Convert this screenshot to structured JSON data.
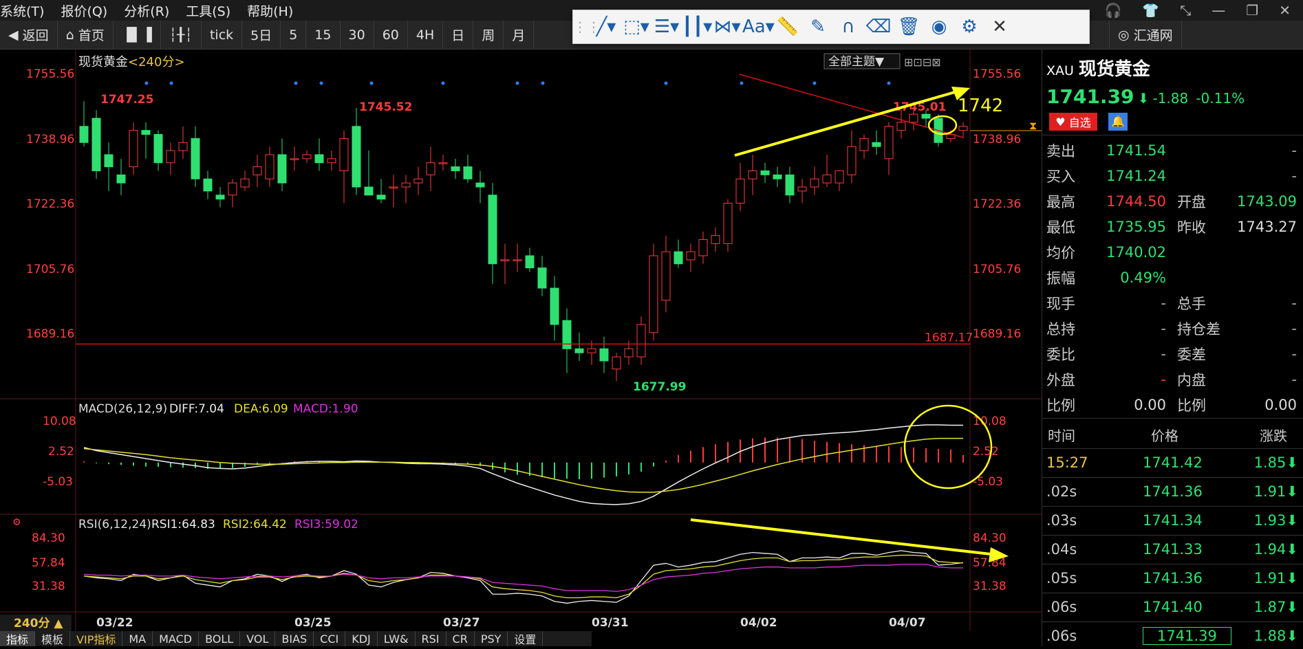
{
  "menu": [
    "系统(T)",
    "报价(Q)",
    "分析(R)",
    "工具(S)",
    "帮助(H)"
  ],
  "window_controls": [
    "headset-icon",
    "shirt-icon",
    "collapse-icon",
    "minimize-icon",
    "restore-icon",
    "close-icon"
  ],
  "toolbar": {
    "back": "返回",
    "home": "首页",
    "periods": [
      "tick",
      "5日",
      "5",
      "15",
      "30",
      "60",
      "4H",
      "日",
      "周",
      "月"
    ],
    "site": "汇通网"
  },
  "drawbar": {
    "font_label": "Aa",
    "tools": [
      "line-tool-icon",
      "rect-tool-icon",
      "fib-tool-icon",
      "channel-tool-icon",
      "pattern-tool-icon",
      "text-tool-icon",
      "ruler-icon",
      "pen-icon",
      "magnet-icon",
      "eraser-icon",
      "trash-icon",
      "eye-icon",
      "gear-icon",
      "close-icon"
    ]
  },
  "chart": {
    "title": "现货黄金",
    "period_label": "<240分>",
    "theme_button": "全部主题▼",
    "price_ticks": [
      "1755.56",
      "1738.96",
      "1722.36",
      "1705.76",
      "1689.16"
    ],
    "high_labels": [
      "1747.25",
      "1745.52",
      "1745.01"
    ],
    "low_label": "1677.99",
    "hline_label": "1687.17",
    "annotation": "1742",
    "date_ticks": [
      "03/22",
      "03/25",
      "03/27",
      "03/31",
      "04/02",
      "04/07"
    ],
    "macd_header": {
      "name": "MACD(26,12,9)",
      "diff": "DIFF:7.04",
      "dea": "DEA:6.09",
      "macd": "MACD:1.90"
    },
    "macd_ticks": [
      "10.08",
      "2.52",
      "-5.03"
    ],
    "rsi_header": {
      "name": "RSI(6,12,24)",
      "rsi1": "RSI1:64.83",
      "rsi2": "RSI2:64.42",
      "rsi3": "RSI3:59.02"
    },
    "rsi_ticks": [
      "84.30",
      "57.84",
      "31.38"
    ],
    "period_select": "240分 ▲"
  },
  "chart_data": {
    "type": "candlestick",
    "title": "现货黄金<240分>",
    "ylim": [
      1675,
      1760
    ],
    "candles": [
      [
        1741,
        1747.25,
        1736,
        1737
      ],
      [
        1743,
        1745,
        1728,
        1730
      ],
      [
        1734,
        1737,
        1725,
        1731
      ],
      [
        1729,
        1733,
        1724,
        1727
      ],
      [
        1731,
        1742,
        1729,
        1740
      ],
      [
        1740,
        1742,
        1733,
        1739
      ],
      [
        1739,
        1740,
        1730,
        1732
      ],
      [
        1732,
        1737,
        1729,
        1735
      ],
      [
        1735,
        1741,
        1733,
        1737
      ],
      [
        1738,
        1741,
        1726,
        1728
      ],
      [
        1728,
        1730,
        1723,
        1725
      ],
      [
        1724,
        1726,
        1721,
        1723
      ],
      [
        1724,
        1728,
        1721,
        1727
      ],
      [
        1726,
        1730,
        1725,
        1728
      ],
      [
        1729,
        1734,
        1726,
        1731
      ],
      [
        1728,
        1736,
        1726,
        1734
      ],
      [
        1734,
        1738,
        1725,
        1727
      ],
      [
        1733,
        1736,
        1730,
        1733
      ],
      [
        1733,
        1735,
        1732,
        1734
      ],
      [
        1734,
        1738,
        1730,
        1732
      ],
      [
        1732,
        1735,
        1730,
        1733
      ],
      [
        1730,
        1740,
        1722,
        1738
      ],
      [
        1741,
        1745.52,
        1724,
        1726
      ],
      [
        1726,
        1735,
        1724,
        1724
      ],
      [
        1724,
        1728,
        1722,
        1723
      ],
      [
        1726,
        1729,
        1721,
        1726
      ],
      [
        1726,
        1729,
        1722,
        1727
      ],
      [
        1727,
        1731,
        1724,
        1728
      ],
      [
        1729,
        1736,
        1725,
        1732
      ],
      [
        1732,
        1734,
        1730,
        1732
      ],
      [
        1731,
        1733,
        1728,
        1730
      ],
      [
        1731,
        1734,
        1727,
        1728
      ],
      [
        1727,
        1730,
        1722,
        1726
      ],
      [
        1724,
        1727,
        1702,
        1707
      ],
      [
        1708,
        1712,
        1702,
        1708
      ],
      [
        1708,
        1712,
        1705,
        1708
      ],
      [
        1709,
        1711,
        1705,
        1706
      ],
      [
        1706,
        1709,
        1699,
        1701
      ],
      [
        1701,
        1704,
        1688,
        1692
      ],
      [
        1693,
        1696,
        1680,
        1686
      ],
      [
        1686,
        1690,
        1683,
        1685
      ],
      [
        1685,
        1688,
        1682,
        1686
      ],
      [
        1686,
        1689,
        1680,
        1683
      ],
      [
        1681,
        1685,
        1677.99,
        1684
      ],
      [
        1684,
        1688,
        1682,
        1686
      ],
      [
        1684,
        1694,
        1682,
        1692
      ],
      [
        1690,
        1712,
        1688,
        1709
      ],
      [
        1698,
        1714,
        1695,
        1710
      ],
      [
        1710,
        1713,
        1706,
        1707
      ],
      [
        1708,
        1712,
        1705,
        1710
      ],
      [
        1709,
        1715,
        1707,
        1713
      ],
      [
        1712,
        1716,
        1710,
        1714
      ],
      [
        1712,
        1723,
        1710,
        1722
      ],
      [
        1722,
        1732,
        1720,
        1728
      ],
      [
        1728,
        1734,
        1724,
        1730
      ],
      [
        1730,
        1732,
        1727,
        1729
      ],
      [
        1729,
        1731,
        1726,
        1728
      ],
      [
        1729,
        1731,
        1722,
        1724
      ],
      [
        1725,
        1728,
        1722,
        1726
      ],
      [
        1726,
        1731,
        1724,
        1728
      ],
      [
        1727,
        1734,
        1726,
        1729
      ],
      [
        1727,
        1730,
        1725,
        1730
      ],
      [
        1729,
        1740,
        1727,
        1736
      ],
      [
        1735,
        1739,
        1733,
        1738
      ],
      [
        1737,
        1740,
        1734,
        1736
      ],
      [
        1733,
        1742,
        1729,
        1741
      ],
      [
        1740,
        1745,
        1738,
        1742
      ],
      [
        1742,
        1745.01,
        1740,
        1744
      ],
      [
        1744,
        1745,
        1741,
        1743
      ],
      [
        1743,
        1744,
        1736,
        1737
      ],
      [
        1738,
        1740,
        1737,
        1739
      ],
      [
        1740,
        1742,
        1738,
        1741
      ]
    ],
    "hline": 1687.17,
    "macd": {
      "ylim": [
        -12,
        14
      ],
      "diff": [
        3.8,
        3,
        2.5,
        2,
        1.5,
        1,
        0.5,
        0,
        -0.4,
        -0.8,
        -1.3,
        -1.5,
        -1.6,
        -1.4,
        -1,
        -0.6,
        -0.3,
        0,
        0.2,
        0.3,
        0.3,
        0.2,
        0.4,
        0.3,
        0.1,
        0,
        -0.2,
        -0.3,
        -0.3,
        -0.4,
        -0.6,
        -0.9,
        -1.5,
        -2.8,
        -4,
        -5.2,
        -6.2,
        -7.2,
        -8.2,
        -9,
        -9.8,
        -10.3,
        -10.5,
        -10.6,
        -10.4,
        -9.8,
        -8.5,
        -6.7,
        -4.9,
        -3.2,
        -1.6,
        -0.1,
        1.3,
        2.8,
        4,
        5,
        5.8,
        6.3,
        6.8,
        7,
        7.3,
        7.5,
        7.7,
        8,
        8.3,
        8.7,
        9,
        9.3,
        9.5,
        9.5,
        9.4,
        9.4
      ],
      "dea": [
        3.5,
        3.2,
        2.9,
        2.6,
        2.3,
        2,
        1.6,
        1.2,
        0.9,
        0.6,
        0.3,
        0,
        -0.2,
        -0.3,
        -0.4,
        -0.4,
        -0.4,
        -0.3,
        -0.2,
        -0.1,
        0,
        0,
        0.1,
        0.1,
        0.1,
        0.1,
        0,
        0,
        -0.1,
        -0.2,
        -0.3,
        -0.4,
        -0.6,
        -1,
        -1.5,
        -2.1,
        -2.8,
        -3.5,
        -4.2,
        -4.9,
        -5.6,
        -6.2,
        -6.7,
        -7.1,
        -7.4,
        -7.5,
        -7.5,
        -7.2,
        -6.8,
        -6.2,
        -5.5,
        -4.7,
        -3.9,
        -3,
        -2.1,
        -1.3,
        -0.5,
        0.2,
        0.9,
        1.5,
        2.1,
        2.6,
        3.1,
        3.6,
        4.1,
        4.6,
        5.1,
        5.5,
        5.9,
        6.1,
        6.1,
        6.09
      ],
      "hist": [
        0.3,
        -0.2,
        -0.4,
        -0.6,
        -0.8,
        -1,
        -1.1,
        -1.2,
        -1.3,
        -1.4,
        -1.6,
        -1.5,
        -1.4,
        -1.1,
        -0.6,
        -0.2,
        0.1,
        0.3,
        0.4,
        0.4,
        0.3,
        0.2,
        0.3,
        0.2,
        0,
        -0.1,
        -0.2,
        -0.3,
        -0.2,
        -0.2,
        -0.3,
        -0.5,
        -0.9,
        -1.8,
        -2.5,
        -3.1,
        -3.4,
        -3.7,
        -4,
        -4.1,
        -4.2,
        -4.1,
        -3.8,
        -3.5,
        -3,
        -2.3,
        -1,
        0.5,
        1.9,
        3,
        3.9,
        4.6,
        5.2,
        5.8,
        6.1,
        6.3,
        6.3,
        6.1,
        5.9,
        5.5,
        5.2,
        4.9,
        4.6,
        4.4,
        4.2,
        4.1,
        3.9,
        3.8,
        3.6,
        3.4,
        3.3,
        1.9
      ]
    },
    "rsi": {
      "ylim": [
        15,
        100
      ],
      "rsi1": [
        50,
        48,
        47,
        45,
        52,
        50,
        45,
        48,
        51,
        42,
        40,
        38,
        45,
        47,
        52,
        50,
        44,
        50,
        52,
        48,
        50,
        56,
        52,
        40,
        38,
        43,
        46,
        48,
        54,
        53,
        50,
        48,
        45,
        30,
        30,
        31,
        30,
        28,
        22,
        20,
        22,
        23,
        22,
        21,
        28,
        45,
        62,
        64,
        60,
        62,
        65,
        66,
        70,
        74,
        76,
        75,
        74,
        66,
        70,
        70,
        71,
        70,
        75,
        75,
        73,
        76,
        78,
        76,
        75,
        62,
        63,
        64.83
      ],
      "rsi2": [
        50,
        49,
        48,
        47,
        50,
        50,
        47,
        48,
        50,
        46,
        44,
        42,
        45,
        46,
        49,
        49,
        46,
        49,
        50,
        49,
        50,
        53,
        51,
        45,
        43,
        45,
        46,
        48,
        51,
        51,
        50,
        49,
        47,
        38,
        36,
        35,
        34,
        32,
        28,
        26,
        26,
        27,
        27,
        26,
        30,
        40,
        52,
        56,
        57,
        58,
        60,
        61,
        64,
        67,
        69,
        70,
        70,
        66,
        67,
        67,
        68,
        68,
        70,
        71,
        71,
        72,
        73,
        73,
        72,
        66,
        65,
        64.42
      ],
      "rsi3": [
        52,
        51,
        51,
        50,
        51,
        51,
        50,
        50,
        51,
        49,
        48,
        47,
        48,
        49,
        50,
        50,
        49,
        50,
        51,
        50,
        50,
        52,
        51,
        48,
        47,
        48,
        48,
        49,
        50,
        50,
        50,
        49,
        48,
        43,
        42,
        41,
        40,
        39,
        36,
        34,
        34,
        34,
        34,
        33,
        35,
        40,
        46,
        49,
        50,
        51,
        53,
        54,
        56,
        58,
        59,
        60,
        60,
        59,
        59,
        59,
        60,
        60,
        61,
        62,
        62,
        62,
        63,
        63,
        63,
        60,
        59,
        59.02
      ]
    }
  },
  "quote": {
    "code": "XAU",
    "name": "现货黄金",
    "price": "1741.39",
    "arrow": "⬇",
    "change": "-1.88",
    "pct": "-0.11%",
    "watch_label": "自选",
    "rows": [
      {
        "l": "卖出",
        "v": "1741.54",
        "l2": "",
        "v2": "-"
      },
      {
        "l": "买入",
        "v": "1741.24",
        "l2": "",
        "v2": "-"
      },
      {
        "l": "最高",
        "v": "1744.50",
        "l2": "开盘",
        "v2": "1743.09"
      },
      {
        "l": "最低",
        "v": "1735.95",
        "l2": "昨收",
        "v2": "1743.27"
      },
      {
        "l": "均价",
        "v": "1740.02",
        "l2": "",
        "v2": ""
      },
      {
        "l": "振幅",
        "v": "0.49%",
        "l2": "",
        "v2": ""
      },
      {
        "l": "现手",
        "v": "-",
        "l2": "总手",
        "v2": "-"
      },
      {
        "l": "总持",
        "v": "-",
        "l2": "持仓差",
        "v2": "-"
      },
      {
        "l": "委比",
        "v": "-",
        "l2": "委差",
        "v2": "-"
      },
      {
        "l": "外盘",
        "v": "-",
        "l2": "内盘",
        "v2": "-"
      },
      {
        "l": "比例",
        "v": "0.00",
        "l2": "比例",
        "v2": "0.00"
      }
    ],
    "tick_headers": [
      "时间",
      "价格",
      "涨跌"
    ],
    "ticks": [
      {
        "t": "15:27",
        "p": "1741.42",
        "c": "1.85⬇"
      },
      {
        "t": ".02s",
        "p": "1741.36",
        "c": "1.91⬇"
      },
      {
        "t": ".03s",
        "p": "1741.34",
        "c": "1.93⬇"
      },
      {
        "t": ".04s",
        "p": "1741.33",
        "c": "1.94⬇"
      },
      {
        "t": ".05s",
        "p": "1741.36",
        "c": "1.91⬇"
      },
      {
        "t": ".06s",
        "p": "1741.40",
        "c": "1.87⬇"
      },
      {
        "t": ".06s",
        "p": "1741.39",
        "c": "1.88⬇"
      }
    ]
  },
  "bottom_tabs": [
    "指标",
    "模板",
    "VIP指标",
    "MA",
    "MACD",
    "BOLL",
    "VOL",
    "BIAS",
    "CCI",
    "KDJ",
    "LW&",
    "RSI",
    "CR",
    "PSY",
    "设置"
  ]
}
